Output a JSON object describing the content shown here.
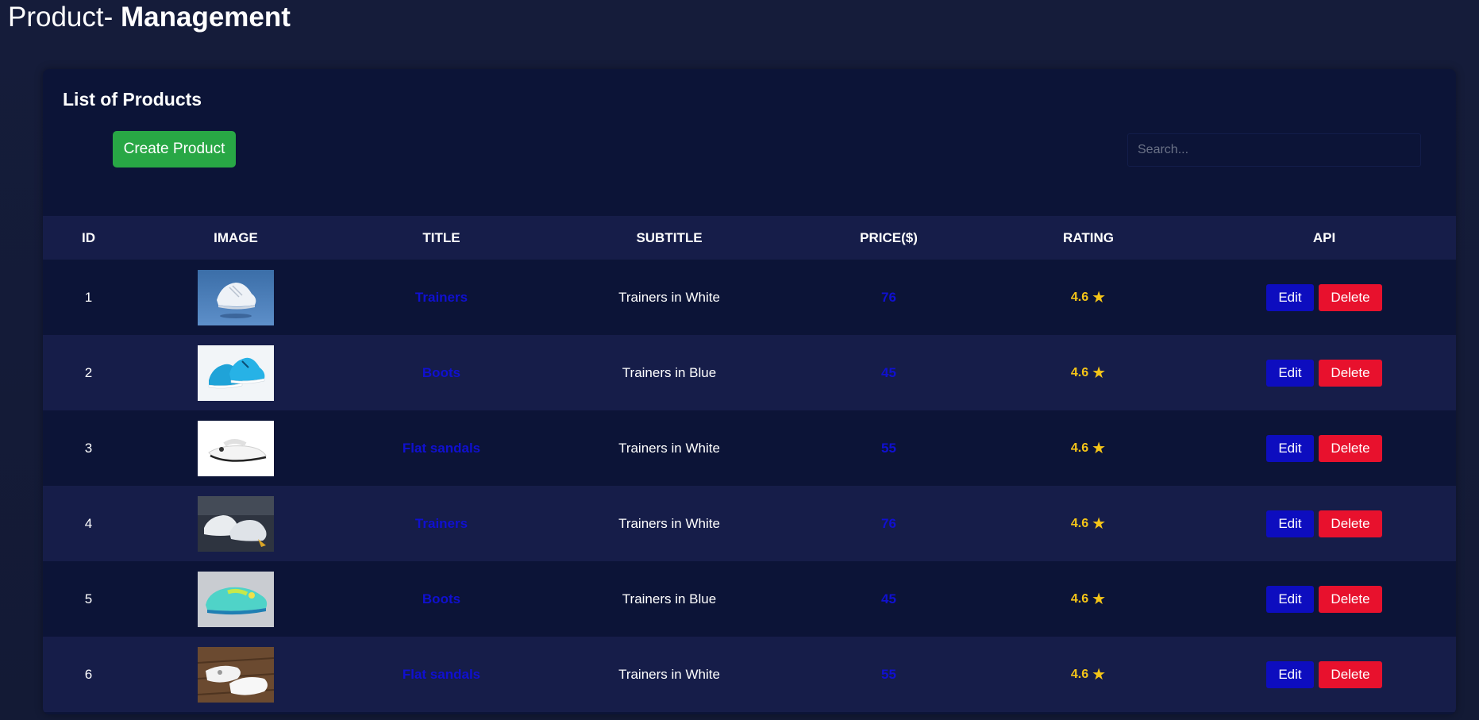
{
  "header": {
    "title_prefix": "Product- ",
    "title_bold": "Management"
  },
  "card": {
    "title": "List of Products",
    "create_button": "Create Product",
    "search_placeholder": "Search..."
  },
  "table": {
    "columns": [
      "ID",
      "IMAGE",
      "TITLE",
      "SUBTITLE",
      "PRICE($)",
      "RATING",
      "API"
    ],
    "edit_label": "Edit",
    "delete_label": "Delete",
    "rows": [
      {
        "id": "1",
        "image": "white-sneaker-floating",
        "title": "Trainers",
        "subtitle": "Trainers in White",
        "price": "76",
        "rating": "4.6"
      },
      {
        "id": "2",
        "image": "blue-running-shoes",
        "title": "Boots",
        "subtitle": "Trainers in Blue",
        "price": "45",
        "rating": "4.6"
      },
      {
        "id": "3",
        "image": "white-flat-sandal",
        "title": "Flat sandals",
        "subtitle": "Trainers in White",
        "price": "55",
        "rating": "4.6"
      },
      {
        "id": "4",
        "image": "white-sneakers-on-mat",
        "title": "Trainers",
        "subtitle": "Trainers in White",
        "price": "76",
        "rating": "4.6"
      },
      {
        "id": "5",
        "image": "turquoise-kids-shoe",
        "title": "Boots",
        "subtitle": "Trainers in Blue",
        "price": "45",
        "rating": "4.6"
      },
      {
        "id": "6",
        "image": "white-sandals-on-wood",
        "title": "Flat sandals",
        "subtitle": "Trainers in White",
        "price": "55",
        "rating": "4.6"
      }
    ]
  },
  "colors": {
    "background": "#151c3a",
    "card": "#0c1437",
    "row_alt": "#161d49",
    "create_button": "#28a745",
    "edit_button": "#0d0dbf",
    "delete_button": "#e8112d",
    "link": "#1010d0",
    "rating": "#f5c518"
  },
  "icons": {
    "rating": "star-icon"
  }
}
